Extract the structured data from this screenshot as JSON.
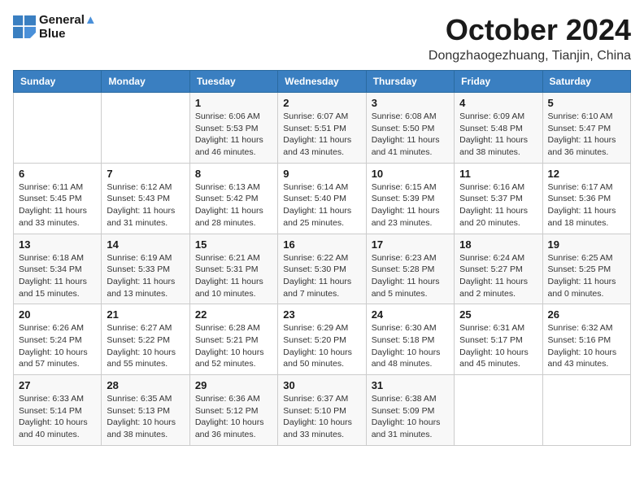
{
  "logo": {
    "line1": "General",
    "line2": "Blue"
  },
  "title": "October 2024",
  "location": "Dongzhaogezhuang, Tianjin, China",
  "days_of_week": [
    "Sunday",
    "Monday",
    "Tuesday",
    "Wednesday",
    "Thursday",
    "Friday",
    "Saturday"
  ],
  "weeks": [
    [
      {
        "day": "",
        "info": ""
      },
      {
        "day": "",
        "info": ""
      },
      {
        "day": "1",
        "info": "Sunrise: 6:06 AM\nSunset: 5:53 PM\nDaylight: 11 hours and 46 minutes."
      },
      {
        "day": "2",
        "info": "Sunrise: 6:07 AM\nSunset: 5:51 PM\nDaylight: 11 hours and 43 minutes."
      },
      {
        "day": "3",
        "info": "Sunrise: 6:08 AM\nSunset: 5:50 PM\nDaylight: 11 hours and 41 minutes."
      },
      {
        "day": "4",
        "info": "Sunrise: 6:09 AM\nSunset: 5:48 PM\nDaylight: 11 hours and 38 minutes."
      },
      {
        "day": "5",
        "info": "Sunrise: 6:10 AM\nSunset: 5:47 PM\nDaylight: 11 hours and 36 minutes."
      }
    ],
    [
      {
        "day": "6",
        "info": "Sunrise: 6:11 AM\nSunset: 5:45 PM\nDaylight: 11 hours and 33 minutes."
      },
      {
        "day": "7",
        "info": "Sunrise: 6:12 AM\nSunset: 5:43 PM\nDaylight: 11 hours and 31 minutes."
      },
      {
        "day": "8",
        "info": "Sunrise: 6:13 AM\nSunset: 5:42 PM\nDaylight: 11 hours and 28 minutes."
      },
      {
        "day": "9",
        "info": "Sunrise: 6:14 AM\nSunset: 5:40 PM\nDaylight: 11 hours and 25 minutes."
      },
      {
        "day": "10",
        "info": "Sunrise: 6:15 AM\nSunset: 5:39 PM\nDaylight: 11 hours and 23 minutes."
      },
      {
        "day": "11",
        "info": "Sunrise: 6:16 AM\nSunset: 5:37 PM\nDaylight: 11 hours and 20 minutes."
      },
      {
        "day": "12",
        "info": "Sunrise: 6:17 AM\nSunset: 5:36 PM\nDaylight: 11 hours and 18 minutes."
      }
    ],
    [
      {
        "day": "13",
        "info": "Sunrise: 6:18 AM\nSunset: 5:34 PM\nDaylight: 11 hours and 15 minutes."
      },
      {
        "day": "14",
        "info": "Sunrise: 6:19 AM\nSunset: 5:33 PM\nDaylight: 11 hours and 13 minutes."
      },
      {
        "day": "15",
        "info": "Sunrise: 6:21 AM\nSunset: 5:31 PM\nDaylight: 11 hours and 10 minutes."
      },
      {
        "day": "16",
        "info": "Sunrise: 6:22 AM\nSunset: 5:30 PM\nDaylight: 11 hours and 7 minutes."
      },
      {
        "day": "17",
        "info": "Sunrise: 6:23 AM\nSunset: 5:28 PM\nDaylight: 11 hours and 5 minutes."
      },
      {
        "day": "18",
        "info": "Sunrise: 6:24 AM\nSunset: 5:27 PM\nDaylight: 11 hours and 2 minutes."
      },
      {
        "day": "19",
        "info": "Sunrise: 6:25 AM\nSunset: 5:25 PM\nDaylight: 11 hours and 0 minutes."
      }
    ],
    [
      {
        "day": "20",
        "info": "Sunrise: 6:26 AM\nSunset: 5:24 PM\nDaylight: 10 hours and 57 minutes."
      },
      {
        "day": "21",
        "info": "Sunrise: 6:27 AM\nSunset: 5:22 PM\nDaylight: 10 hours and 55 minutes."
      },
      {
        "day": "22",
        "info": "Sunrise: 6:28 AM\nSunset: 5:21 PM\nDaylight: 10 hours and 52 minutes."
      },
      {
        "day": "23",
        "info": "Sunrise: 6:29 AM\nSunset: 5:20 PM\nDaylight: 10 hours and 50 minutes."
      },
      {
        "day": "24",
        "info": "Sunrise: 6:30 AM\nSunset: 5:18 PM\nDaylight: 10 hours and 48 minutes."
      },
      {
        "day": "25",
        "info": "Sunrise: 6:31 AM\nSunset: 5:17 PM\nDaylight: 10 hours and 45 minutes."
      },
      {
        "day": "26",
        "info": "Sunrise: 6:32 AM\nSunset: 5:16 PM\nDaylight: 10 hours and 43 minutes."
      }
    ],
    [
      {
        "day": "27",
        "info": "Sunrise: 6:33 AM\nSunset: 5:14 PM\nDaylight: 10 hours and 40 minutes."
      },
      {
        "day": "28",
        "info": "Sunrise: 6:35 AM\nSunset: 5:13 PM\nDaylight: 10 hours and 38 minutes."
      },
      {
        "day": "29",
        "info": "Sunrise: 6:36 AM\nSunset: 5:12 PM\nDaylight: 10 hours and 36 minutes."
      },
      {
        "day": "30",
        "info": "Sunrise: 6:37 AM\nSunset: 5:10 PM\nDaylight: 10 hours and 33 minutes."
      },
      {
        "day": "31",
        "info": "Sunrise: 6:38 AM\nSunset: 5:09 PM\nDaylight: 10 hours and 31 minutes."
      },
      {
        "day": "",
        "info": ""
      },
      {
        "day": "",
        "info": ""
      }
    ]
  ]
}
